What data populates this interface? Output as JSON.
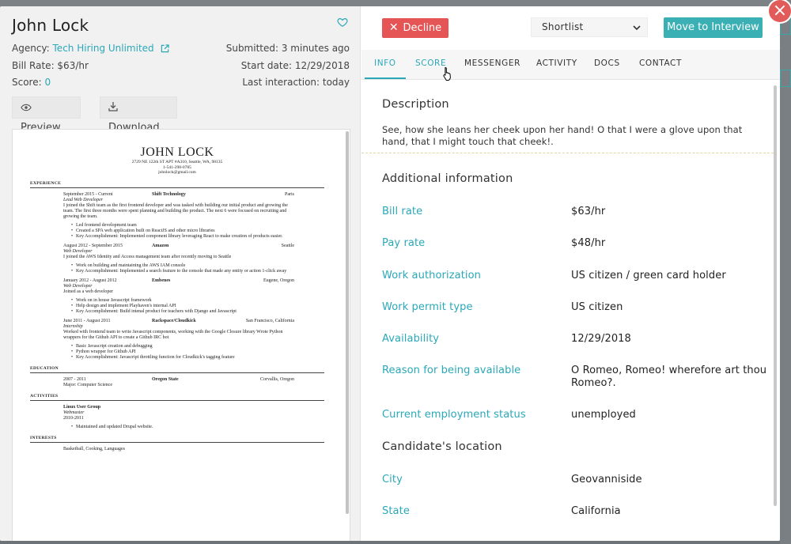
{
  "candidate": {
    "name": "John Lock",
    "agency_label": "Agency:",
    "agency": "Tech Hiring Unlimited",
    "bill_rate": "Bill Rate: $63/hr",
    "score_label": "Score:",
    "score": "0",
    "submitted": "Submitted: 3 minutes ago",
    "start_date": "Start date: 12/29/2018",
    "last_interaction": "Last interaction: today"
  },
  "buttons": {
    "preview": "Preview",
    "download": "Download",
    "decline": "Decline",
    "move": "Move to Interview",
    "close": "×"
  },
  "status_select": {
    "value": "Shortlist"
  },
  "tabs": [
    {
      "label": "INFO",
      "state": "active"
    },
    {
      "label": "SCORE",
      "state": "hover"
    },
    {
      "label": "MESSENGER",
      "state": ""
    },
    {
      "label": "ACTIVITY",
      "state": ""
    },
    {
      "label": "DOCS",
      "state": ""
    },
    {
      "label": "CONTACT",
      "state": ""
    }
  ],
  "description": {
    "heading": "Description",
    "text": "See, how she leans her cheek upon her hand! O that I were a glove upon that hand, that I might touch that cheek!."
  },
  "additional": {
    "heading": "Additional information",
    "rows": [
      {
        "label": "Bill rate",
        "value": "$63/hr"
      },
      {
        "label": "Pay rate",
        "value": "$48/hr"
      },
      {
        "label": "Work authorization",
        "value": "US citizen / green card holder"
      },
      {
        "label": "Work permit type",
        "value": "US citizen"
      },
      {
        "label": "Availability",
        "value": "12/29/2018"
      },
      {
        "label": "Reason for being available",
        "value": "O Romeo, Romeo! wherefore art thou Romeo?."
      },
      {
        "label": "Current employment status",
        "value": "unemployed"
      }
    ]
  },
  "location": {
    "heading": "Candidate's location",
    "rows": [
      {
        "label": "City",
        "value": "Geovanniside"
      },
      {
        "label": "State",
        "value": "California"
      }
    ]
  },
  "resume": {
    "name": "JOHN LOCK",
    "address": "2729 NE 122th ST APT #A310, Seattle, WA, 98135",
    "phone": "1-541-298-0785",
    "email": "johnlock@gmail.com",
    "experience_heading": "EXPERIENCE",
    "jobs": [
      {
        "dates": "September 2015 - Current",
        "company": "Shift Technology",
        "location": "Paris",
        "title": "Lead Web Developer",
        "summary": "I joined the Shift team as the first frontend developer and was tasked with building our initial product and growing the team. The first three months were spent planning and building the product. The next 6 were focused on recruiting and growing the team.",
        "bullets": [
          "Led frontend development team",
          "Created a SPA web application built on ReactJS and other micro libraries",
          "Key Accomplishment: Implemented component library leveraging React to make creation of products easier."
        ]
      },
      {
        "dates": "August 2012 - September 2015",
        "company": "Amazon",
        "location": "Seattle",
        "title": "Web Developer",
        "summary": "I joined the AWS Identity and Access management team after recently moving to Seattle",
        "bullets": [
          "Work on building and maintaining the AWS IAM console",
          "Key Accomplishment: Implemented a search feature to the console that made any entity or action 1-click away"
        ]
      },
      {
        "dates": "January 2012 - August 2012",
        "company": "Embenes",
        "location": "Eugene, Oregon",
        "title": "Web Developer",
        "summary": "Joined as a web developer",
        "bullets": [
          "Work on in house Javascript framework",
          "Help design and implement Playhaven's internal API",
          "Key Accomplishment: Build intenal product for teachers with Django and Javascript"
        ]
      },
      {
        "dates": "June 2011 - August 2011",
        "company": "Rackspace/Cloudkick",
        "location": "San Francisco, California",
        "title": "Internship",
        "summary": "Worked with frontend team to write Javascript components, working with the Google Closure library Wrote Python wrappers for the Github API to create a Github IRC bot",
        "bullets": [
          "Basic Javascript creation and debugging",
          "Python wrapper for Github API",
          "Key Accomplishment: Javascript throttling function for Cloudkick's tagging feature"
        ]
      }
    ],
    "education_heading": "EDUCATION",
    "education": {
      "dates": "2007 - 2011",
      "school": "Oregon State",
      "location": "Corvallis, Oregon",
      "major": "Major: Computer Science"
    },
    "activities_heading": "ACTIVITIES",
    "activity": {
      "name": "Linux User Group",
      "role": "Webmaster",
      "dates": "2010-2011",
      "bullet": "Maintained and updated Drupal website."
    },
    "interests_heading": "INTERESTS",
    "interests": "Basketball, Cooking, Languages"
  },
  "colors": {
    "accent": "#2aa8b8",
    "decline": "#e65555",
    "move": "#3ab0b5",
    "close": "#e25b5b"
  },
  "icons": [
    "heart-icon",
    "external-link-icon",
    "eye-icon",
    "download-icon",
    "close-x-icon",
    "chevron-down-icon",
    "pointer-cursor-icon"
  ]
}
